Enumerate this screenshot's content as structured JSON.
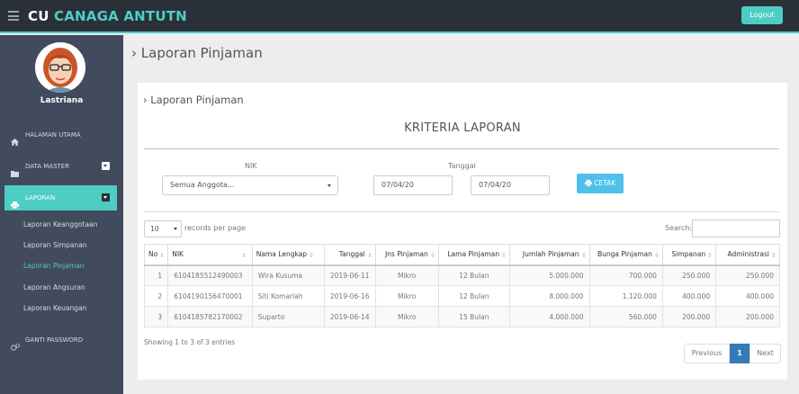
{
  "app": {
    "brand_part1": "CU",
    "brand_part2": "CANAGA ANTUTN",
    "logout_label": "Logout",
    "accent_color": "#4ecdc4",
    "topbar_color": "#2a3038",
    "sidebar_color": "#424a5d"
  },
  "sidebar": {
    "username": "Lastriana",
    "menu": [
      {
        "label": "HALAMAN UTAMA",
        "icon": "home-icon"
      },
      {
        "label": "DATA MASTER",
        "icon": "folder-icon"
      },
      {
        "label": "LAPORAN",
        "icon": "print-icon"
      },
      {
        "label": "GANTI PASSWORD",
        "icon": "gears-icon"
      }
    ],
    "submenu": [
      "Laporan Keanggotaan",
      "Laporan Simpanan",
      "Laporan Pinjaman",
      "Laporan Angsuran",
      "Laporan Keuangan"
    ]
  },
  "page": {
    "title": "Laporan Pinjaman",
    "panel_title": "Laporan Pinjaman",
    "kriteria": "KRITERIA LAPORAN"
  },
  "filters": {
    "nik_label": "NIK",
    "nik_value": "Semua Anggota...",
    "tanggal_label": "Tanggal",
    "date_from": "07/04/20",
    "date_to": "07/04/20",
    "cetak_label": "CETAK"
  },
  "table_controls": {
    "page_length": "10",
    "page_length_label": "records per page",
    "search_label": "Search:"
  },
  "table": {
    "columns": [
      "No",
      "NIK",
      "Nama Lengkap",
      "Tanggal",
      "Jns Pinjaman",
      "Lama Pinjaman",
      "Jumlah Pinjaman",
      "Bunga Pinjaman",
      "Simpanan",
      "Administrasi"
    ],
    "rows": [
      [
        "1",
        "6104185512490003",
        "Wira Kusuma",
        "2019-06-11",
        "Mikro",
        "12 Bulan",
        "5.000.000",
        "700.000",
        "250.000",
        "250.000"
      ],
      [
        "2",
        "6104190156470001",
        "Siti Komariah",
        "2019-06-16",
        "Mikro",
        "12 Bulan",
        "8.000.000",
        "1.120.000",
        "400.000",
        "400.000"
      ],
      [
        "3",
        "6104185782170002",
        "Suparto",
        "2019-06-14",
        "Mikro",
        "15 Bulan",
        "4.000.000",
        "560.000",
        "200.000",
        "200.000"
      ]
    ]
  },
  "footer": {
    "info": "Showing 1 to 3 of 3 entries",
    "previous": "Previous",
    "current_page": "1",
    "next": "Next"
  }
}
